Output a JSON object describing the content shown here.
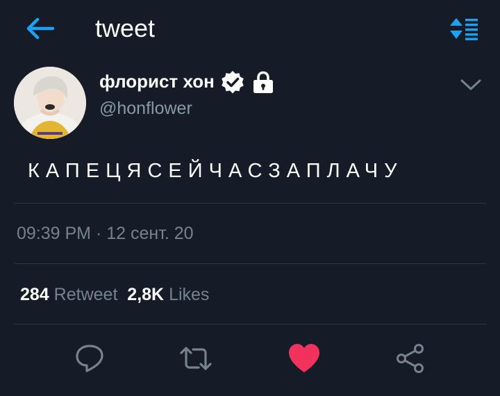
{
  "header": {
    "title": "tweet"
  },
  "user": {
    "name": "флорист хон",
    "handle": "@honflower"
  },
  "tweet": {
    "text": "КАПЕЦЯСЕЙЧАСЗАПЛАЧУ",
    "time": "09:39 PM",
    "date_separator": " · ",
    "date": "12 сент. 20",
    "retweet_count": "284",
    "retweet_label": "Retweet",
    "likes_count": "2,8K",
    "likes_label": "Likes"
  },
  "colors": {
    "background": "#151c27",
    "accent": "#1da1f2",
    "like": "#f0325c",
    "muted": "#76828e"
  },
  "icons": [
    "back-arrow-icon",
    "sort-icon",
    "verified-badge-icon",
    "lock-icon",
    "chevron-down-icon",
    "reply-icon",
    "retweet-icon",
    "like-icon",
    "share-icon"
  ]
}
